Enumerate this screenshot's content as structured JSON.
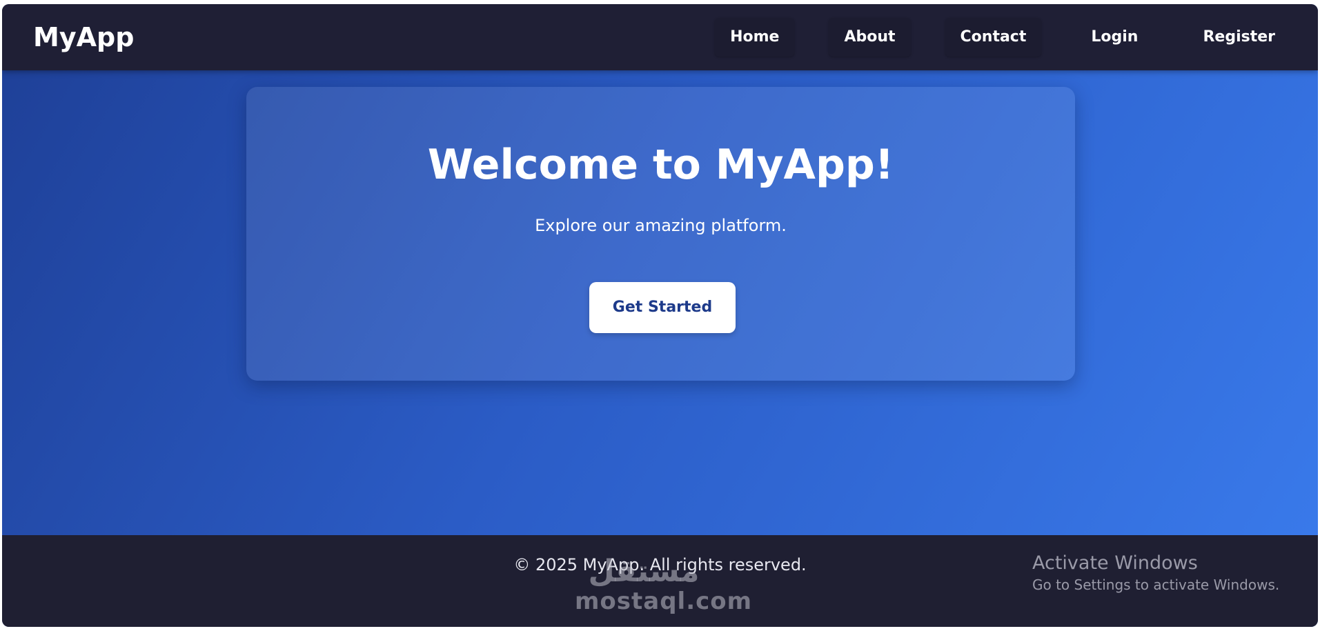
{
  "navbar": {
    "brand": "MyApp",
    "links": [
      "Home",
      "About",
      "Contact",
      "Login",
      "Register"
    ]
  },
  "hero": {
    "title": "Welcome to MyApp!",
    "subtitle": "Explore our amazing platform.",
    "cta_label": "Get Started"
  },
  "footer": {
    "copyright": "© 2025 MyApp. All rights reserved."
  },
  "watermark": {
    "arabic": "مستقل",
    "latin": "mostaql.com"
  },
  "os_overlay": {
    "title": "Activate Windows",
    "subtitle": "Go to Settings to activate Windows."
  },
  "colors": {
    "navbar_bg": "#1f1f35",
    "hero_gradient_start": "#1e3f96",
    "hero_gradient_end": "#3a7bec",
    "cta_text": "#1d3a8a",
    "footer_bg": "#1f1f32"
  }
}
